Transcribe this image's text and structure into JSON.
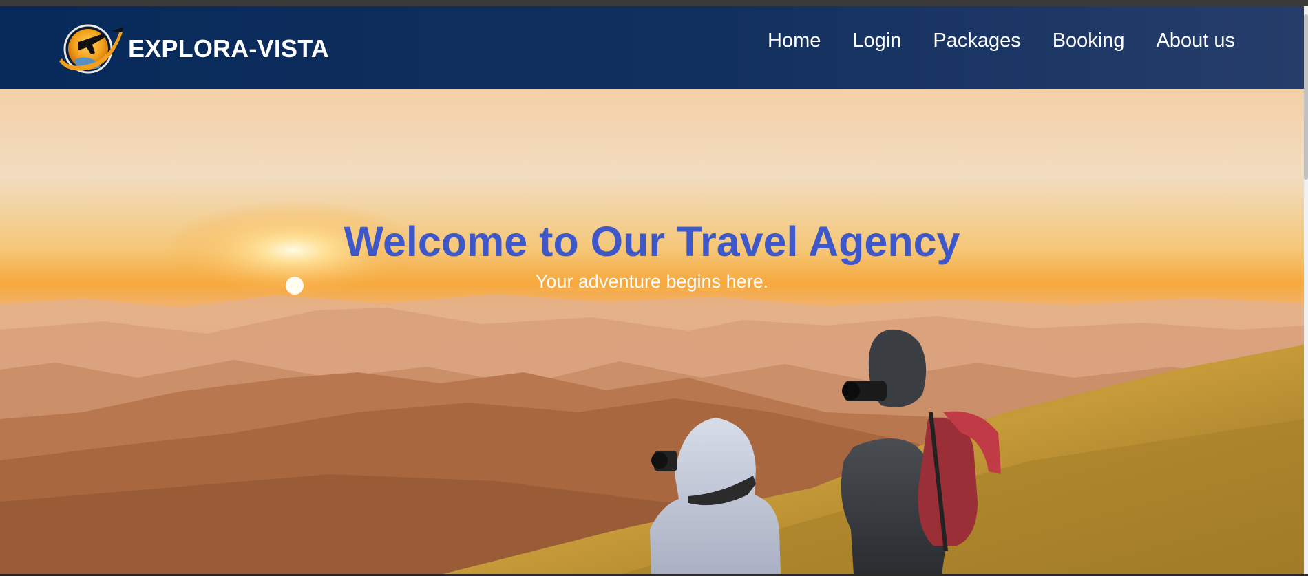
{
  "navbar": {
    "brand_name": "EXPLORA-VISTA",
    "logo_icon": "globe-airplane-logo-icon",
    "links": [
      {
        "label": "Home"
      },
      {
        "label": "Login"
      },
      {
        "label": "Packages"
      },
      {
        "label": "Booking"
      },
      {
        "label": "About us"
      }
    ]
  },
  "hero": {
    "title": "Welcome to Our Travel Agency",
    "subtitle": "Your adventure begins here.",
    "image": "two-photographers-on-mountain-at-sunrise",
    "title_color": "#3e57c9"
  },
  "colors": {
    "navbar_start": "#072a5a",
    "navbar_end": "#263d6a",
    "accent": "#f2a01a"
  }
}
